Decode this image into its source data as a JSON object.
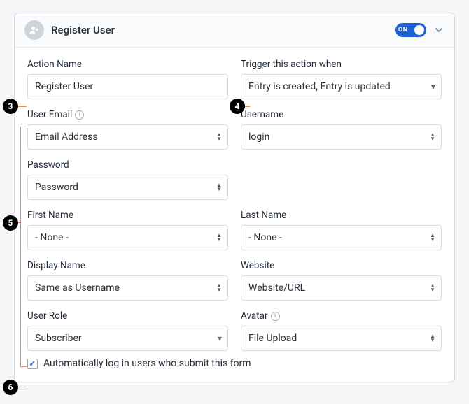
{
  "header": {
    "title": "Register User",
    "toggle_label": "ON"
  },
  "fields": {
    "action_name": {
      "label": "Action Name",
      "value": "Register User"
    },
    "trigger": {
      "label": "Trigger this action when",
      "value": "Entry is created, Entry is updated"
    },
    "user_email": {
      "label": "User Email",
      "value": "Email Address"
    },
    "username": {
      "label": "Username",
      "value": "login"
    },
    "password": {
      "label": "Password",
      "value": "Password"
    },
    "first_name": {
      "label": "First Name",
      "value": "- None -"
    },
    "last_name": {
      "label": "Last Name",
      "value": "- None -"
    },
    "display_name": {
      "label": "Display Name",
      "value": "Same as Username"
    },
    "website": {
      "label": "Website",
      "value": "Website/URL"
    },
    "user_role": {
      "label": "User Role",
      "value": "Subscriber"
    },
    "avatar": {
      "label": "Avatar",
      "value": "File Upload"
    }
  },
  "auto_login": {
    "label": "Automatically log in users who submit this form",
    "checked": true
  },
  "annotations": {
    "b3": "3",
    "b4": "4",
    "b5": "5",
    "b6": "6"
  }
}
